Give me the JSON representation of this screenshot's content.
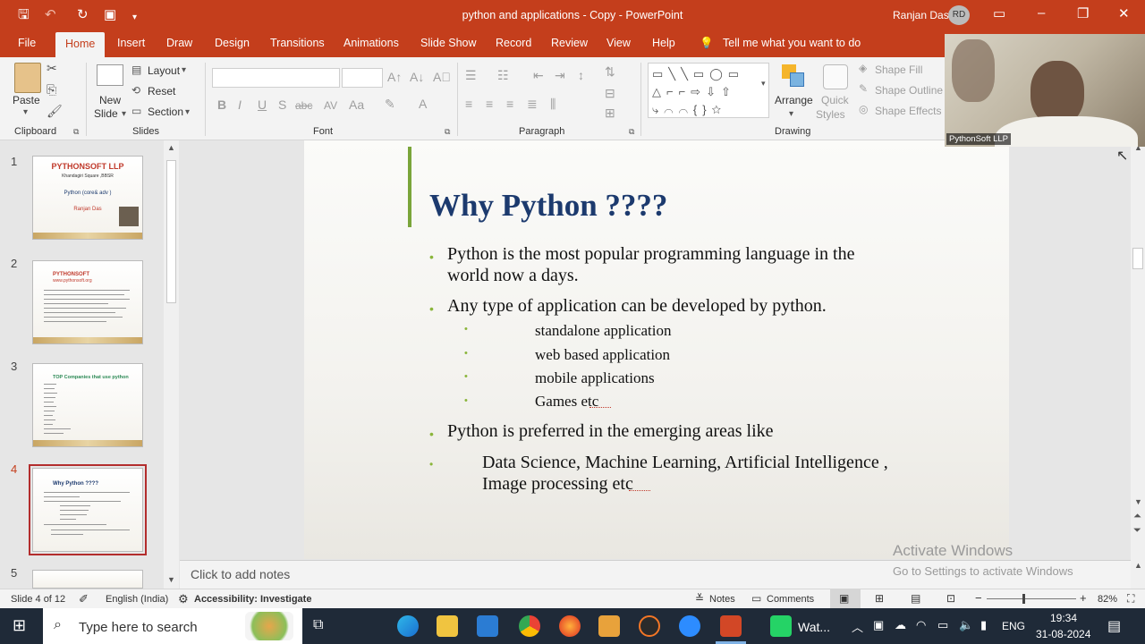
{
  "window": {
    "title": "python and applications - Copy  -  PowerPoint",
    "user": "Ranjan Das",
    "user_initials": "RD"
  },
  "tabs": [
    "File",
    "Home",
    "Insert",
    "Draw",
    "Design",
    "Transitions",
    "Animations",
    "Slide Show",
    "Record",
    "Review",
    "View",
    "Help"
  ],
  "tell_me": "Tell me what you want to do",
  "ribbon": {
    "clipboard": {
      "paste": "Paste",
      "label": "Clipboard"
    },
    "slides": {
      "new_slide_1": "New",
      "new_slide_2": "Slide",
      "layout": "Layout",
      "reset": "Reset",
      "section": "Section",
      "label": "Slides"
    },
    "font": {
      "label": "Font",
      "format": [
        "B",
        "I",
        "U",
        "S",
        "abc",
        "AV",
        "Aa"
      ]
    },
    "paragraph": {
      "label": "Paragraph"
    },
    "drawing": {
      "label": "Drawing",
      "arrange": "Arrange",
      "quick_styles_1": "Quick",
      "quick_styles_2": "Styles",
      "shape_fill": "Shape Fill",
      "shape_outline": "Shape Outline",
      "shape_effects": "Shape Effects"
    }
  },
  "thumbnails": [
    {
      "num": "1",
      "title": "PYTHONSOFT  LLP",
      "sub": "Khandagiri Square ,BBSR",
      "line3": "Python (core& adv )",
      "line4": "Ranjan  Das"
    },
    {
      "num": "2",
      "title": "PYTHONSOFT",
      "sub": "www.pythonsoft.org"
    },
    {
      "num": "3",
      "title": "TOP Companies that use python"
    },
    {
      "num": "4",
      "title": "Why  Python ????"
    },
    {
      "num": "5"
    }
  ],
  "slide": {
    "title": "Why  Python ????",
    "bullets": [
      {
        "lines": [
          "Python is the most popular programming language  in the",
          "world  now a days."
        ]
      },
      {
        "lines": [
          "Any type of application can be developed by python."
        ]
      },
      {
        "lines": [
          "standalone application"
        ]
      },
      {
        "lines": [
          "web based application"
        ]
      },
      {
        "lines": [
          "mobile applications"
        ]
      },
      {
        "lines": [
          "Games  etc"
        ]
      },
      {
        "lines": [
          "Python is preferred in the emerging areas like"
        ]
      },
      {
        "lines": [
          "Data Science, Machine Learning, Artificial Intelligence ,",
          "Image  processing etc"
        ]
      }
    ]
  },
  "notes_placeholder": "Click to add notes",
  "watermark": {
    "line1": "Activate Windows",
    "line2": "Go to Settings to activate Windows"
  },
  "status": {
    "slide": "Slide 4 of 12",
    "language": "English (India)",
    "accessibility": "Accessibility: Investigate",
    "notes": "Notes",
    "comments": "Comments",
    "zoom": "82%"
  },
  "taskbar": {
    "search": "Type here to search",
    "app_label": "Wat...",
    "lang": "ENG",
    "time": "19:34",
    "date": "31-08-2024"
  },
  "webcam": {
    "label": "PythonSoft  LLP"
  },
  "colors": {
    "accent": "#c43e1c",
    "title_blue": "#1c3a6e",
    "bullet_green": "#8ab53a"
  }
}
